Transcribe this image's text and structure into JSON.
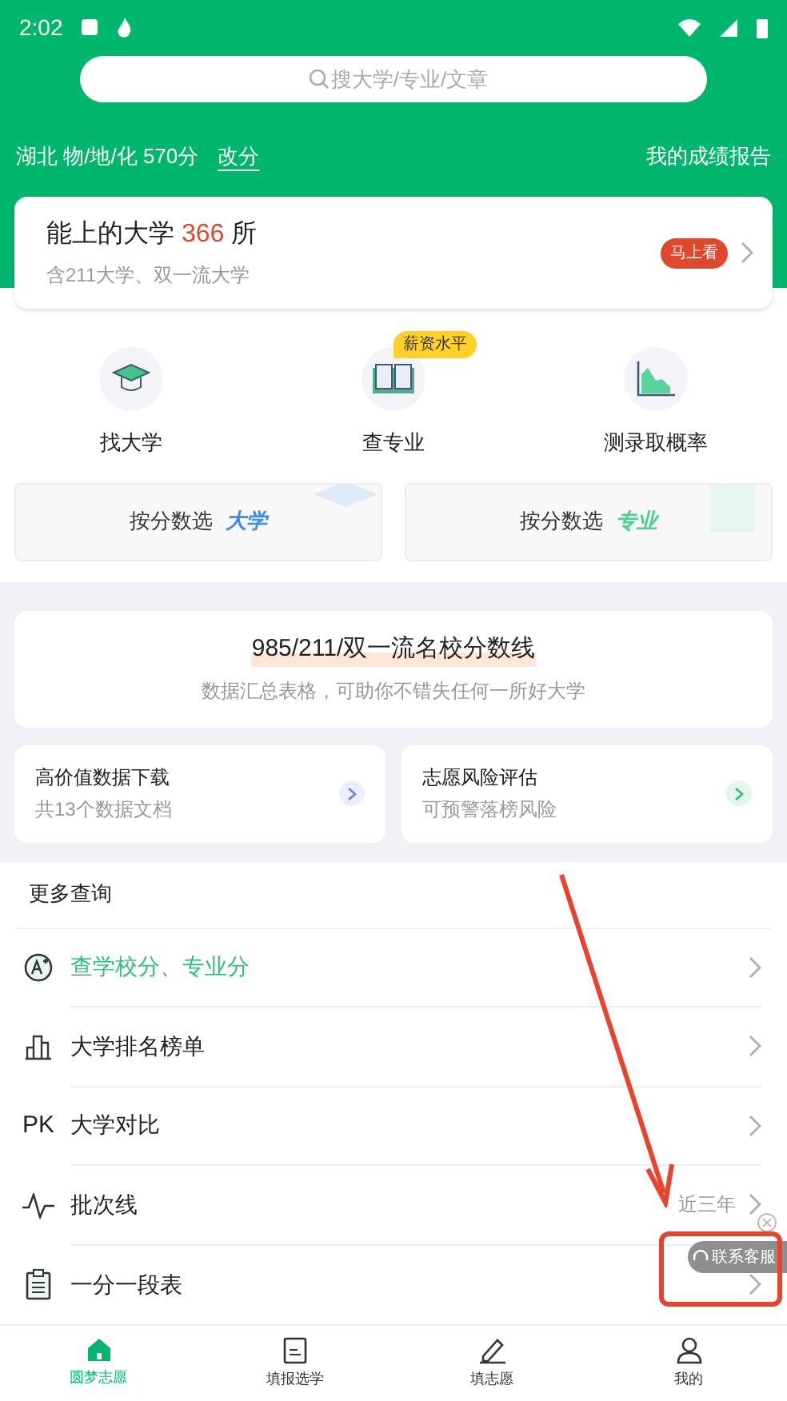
{
  "status_bar": {
    "time": "2:02"
  },
  "search": {
    "placeholder": "搜大学/专业/文章"
  },
  "score_bar": {
    "info": "湖北 物/地/化 570分",
    "edit": "改分",
    "report": "我的成绩报告"
  },
  "summary_card": {
    "title": "能上的大学",
    "count": "366",
    "unit": "所",
    "subtitle": "含211大学、双一流大学",
    "action": "马上看"
  },
  "features": [
    {
      "label": "找大学",
      "kind": "cap"
    },
    {
      "label": "查专业",
      "kind": "book",
      "badge": "薪资水平"
    },
    {
      "label": "测录取概率",
      "kind": "chart"
    }
  ],
  "quick_buttons": [
    {
      "label": "按分数选",
      "highlight": "大学",
      "color": "#3b8cf5"
    },
    {
      "label": "按分数选",
      "highlight": "专业",
      "color": "#4fd08f"
    }
  ],
  "banner": {
    "title": "985/211/双一流名校分数线",
    "subtitle": "数据汇总表格，可助你不错失任何一所好大学"
  },
  "mini_cards": [
    {
      "title": "高价值数据下载",
      "subtitle": "共13个数据文档",
      "color": "#6a7ef0"
    },
    {
      "title": "志愿风险评估",
      "subtitle": "可预警落榜风险",
      "color": "#2fbf7a"
    }
  ],
  "more": {
    "heading": "更多查询",
    "items": [
      {
        "kind": "grade",
        "label": "查学校分、专业分",
        "selected": true
      },
      {
        "kind": "ranking",
        "label": "大学排名榜单",
        "selected": false
      },
      {
        "kind": "pk",
        "icon_text": "PK",
        "label": "大学对比",
        "selected": false
      },
      {
        "kind": "line",
        "label": "批次线",
        "note": "近三年",
        "selected": false
      },
      {
        "kind": "clipboard",
        "label": "一分一段表",
        "selected": false
      }
    ]
  },
  "contact": {
    "label": "联系客服"
  },
  "nav": [
    {
      "label": "圆梦志愿",
      "kind": "home",
      "selected": true
    },
    {
      "label": "填报选学",
      "kind": "doc",
      "selected": false
    },
    {
      "label": "填志愿",
      "kind": "pen",
      "selected": false
    },
    {
      "label": "我的",
      "kind": "user",
      "selected": false
    }
  ]
}
